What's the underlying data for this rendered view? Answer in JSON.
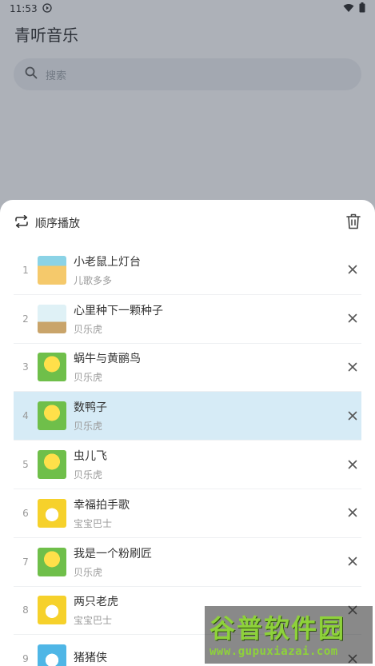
{
  "status_bar": {
    "time": "11:53"
  },
  "app": {
    "title": "青听音乐"
  },
  "search": {
    "placeholder": "搜索"
  },
  "playlist_sheet": {
    "mode_label": "顺序播放",
    "items": [
      {
        "index": "1",
        "title": "小老鼠上灯台",
        "artist": "儿歌多多",
        "active": false
      },
      {
        "index": "2",
        "title": "心里种下一颗种子",
        "artist": "贝乐虎",
        "active": false
      },
      {
        "index": "3",
        "title": "蜗牛与黄鹂鸟",
        "artist": "贝乐虎",
        "active": false
      },
      {
        "index": "4",
        "title": "数鸭子",
        "artist": "贝乐虎",
        "active": true
      },
      {
        "index": "5",
        "title": "虫儿飞",
        "artist": "贝乐虎",
        "active": false
      },
      {
        "index": "6",
        "title": "幸福拍手歌",
        "artist": "宝宝巴士",
        "active": false
      },
      {
        "index": "7",
        "title": "我是一个粉刷匠",
        "artist": "贝乐虎",
        "active": false
      },
      {
        "index": "8",
        "title": "两只老虎",
        "artist": "宝宝巴士",
        "active": false
      },
      {
        "index": "9",
        "title": "猪猪侠",
        "artist": "",
        "active": false
      }
    ]
  },
  "watermark": {
    "main": "谷普软件园",
    "url": "www.gupuxiazai.com"
  },
  "colors": {
    "active_row": "#d6ebf6",
    "overlay": "#3c4655",
    "watermark_green": "#8ed23a"
  }
}
